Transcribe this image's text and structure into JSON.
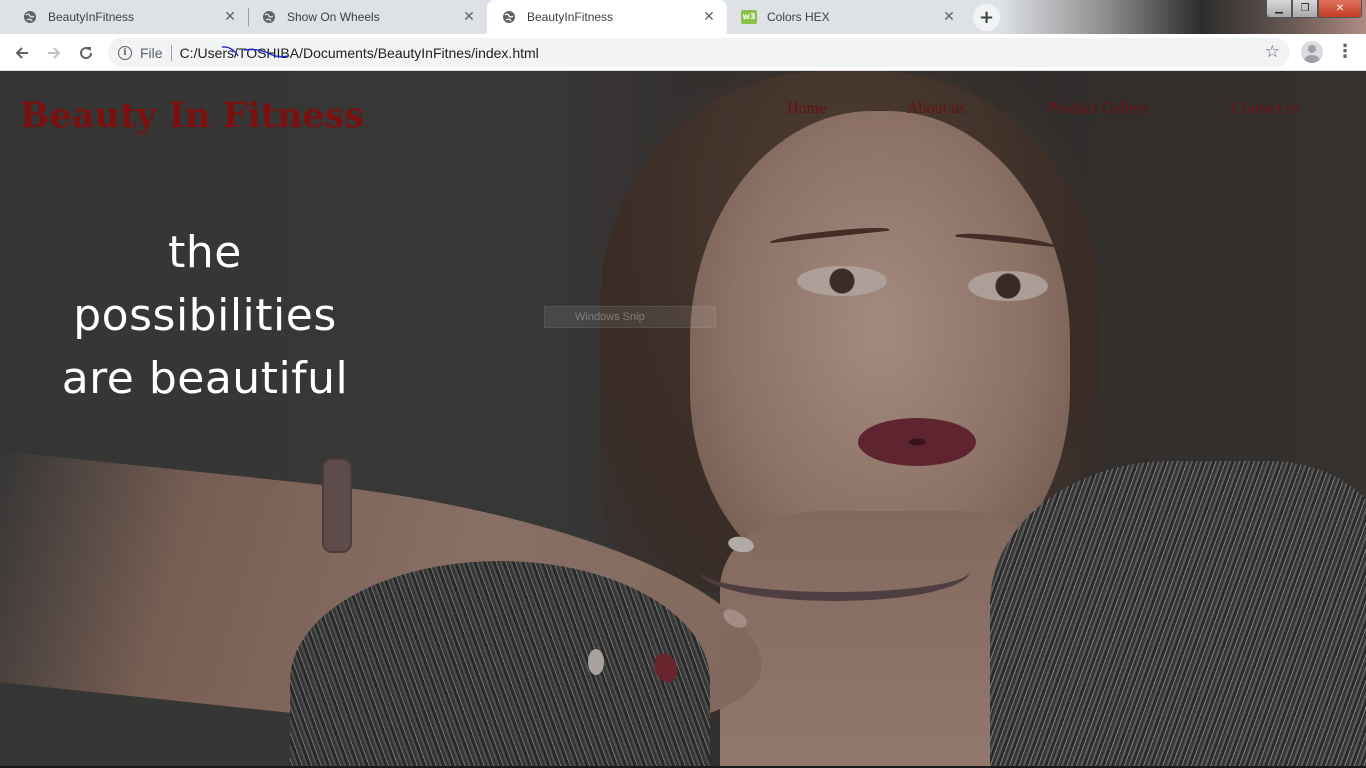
{
  "browser": {
    "tabs": [
      {
        "title": "BeautyInFitness",
        "icon": "globe-icon",
        "active": false
      },
      {
        "title": "Show On Wheels",
        "icon": "globe-icon",
        "active": false
      },
      {
        "title": "BeautyInFitness",
        "icon": "globe-icon",
        "active": true
      },
      {
        "title": "Colors HEX",
        "icon": "w3schools-icon",
        "icon_text": "w3",
        "active": false
      }
    ],
    "close_glyph": "✕",
    "new_tab_glyph": "+",
    "omnibox": {
      "chip": "File",
      "url": "C:/Users/TOSHIBA/Documents/BeautyInFitnes/index.html"
    },
    "window_controls": {
      "minimize": "▁",
      "restore": "❐",
      "close": "✕"
    }
  },
  "site": {
    "brand": "Beauty In Fitness",
    "nav": [
      "Home",
      "About us",
      "Product Gallery",
      "Contact us"
    ],
    "tagline_lines": [
      "the",
      "possibilities",
      "are beautiful"
    ],
    "ghost_label": "Windows Snip"
  },
  "colors": {
    "brand": "#7a1010",
    "nav": "#6b0f0f",
    "tagline": "#ffffff",
    "active_tab": "#ffffff",
    "tab_strip": "#dee1e6"
  }
}
